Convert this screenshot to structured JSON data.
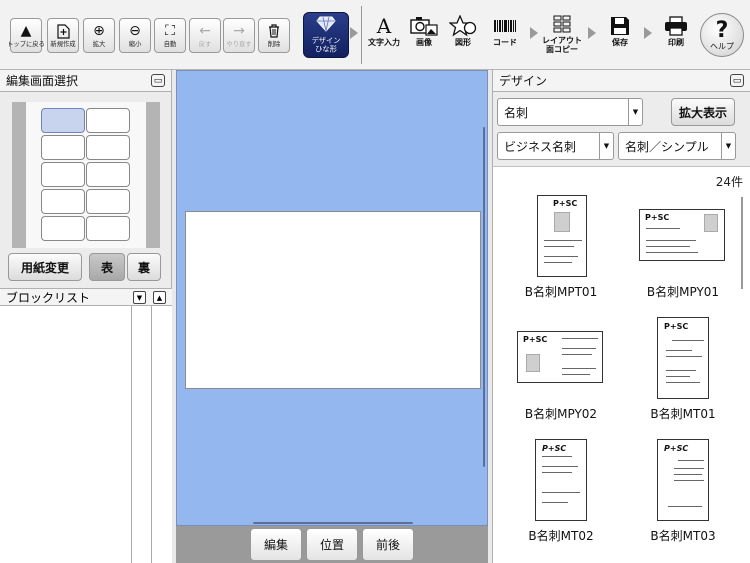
{
  "toolbar": {
    "buttons": [
      {
        "label": "トップに戻る",
        "icon": "▲"
      },
      {
        "label": "新規作成",
        "icon": "⊕"
      },
      {
        "label": "拡大",
        "icon": "⊕"
      },
      {
        "label": "縮小",
        "icon": "⊖"
      },
      {
        "label": "自動",
        "icon": "⛶"
      },
      {
        "label": "戻す",
        "icon": "←"
      },
      {
        "label": "やり直す",
        "icon": "→"
      },
      {
        "label": "削除",
        "icon": "🗑"
      }
    ],
    "design_label": "デザイン\nひな形",
    "tools": [
      {
        "label": "文字入力",
        "icon": "A"
      },
      {
        "label": "画像",
        "icon": "📷"
      },
      {
        "label": "図形",
        "icon": "☆"
      },
      {
        "label": "コード",
        "icon": "▮▮▮"
      },
      {
        "label": "レイアウト\n面コピー",
        "icon": "▦"
      },
      {
        "label": "保存",
        "icon": "💾"
      },
      {
        "label": "印刷",
        "icon": "🖶"
      }
    ],
    "help_label": "ヘルプ",
    "help_icon": "?"
  },
  "left": {
    "title": "編集画面選択",
    "paper_change": "用紙変更",
    "front": "表",
    "back": "裏",
    "blocklist_title": "ブロックリスト"
  },
  "canvas": {
    "edit": "編集",
    "position": "位置",
    "order": "前後"
  },
  "right": {
    "title": "デザイン",
    "category": "名刺",
    "zoom_button": "拡大表示",
    "subcategory": "ビジネス名刺",
    "style": "名刺／シンプル",
    "count": "24件",
    "items": [
      {
        "name": "B名刺MPT01"
      },
      {
        "name": "B名刺MPY01"
      },
      {
        "name": "B名刺MPY02"
      },
      {
        "name": "B名刺MT01"
      },
      {
        "name": "B名刺MT02"
      },
      {
        "name": "B名刺MT03"
      }
    ],
    "logo_text": "P+SC"
  }
}
